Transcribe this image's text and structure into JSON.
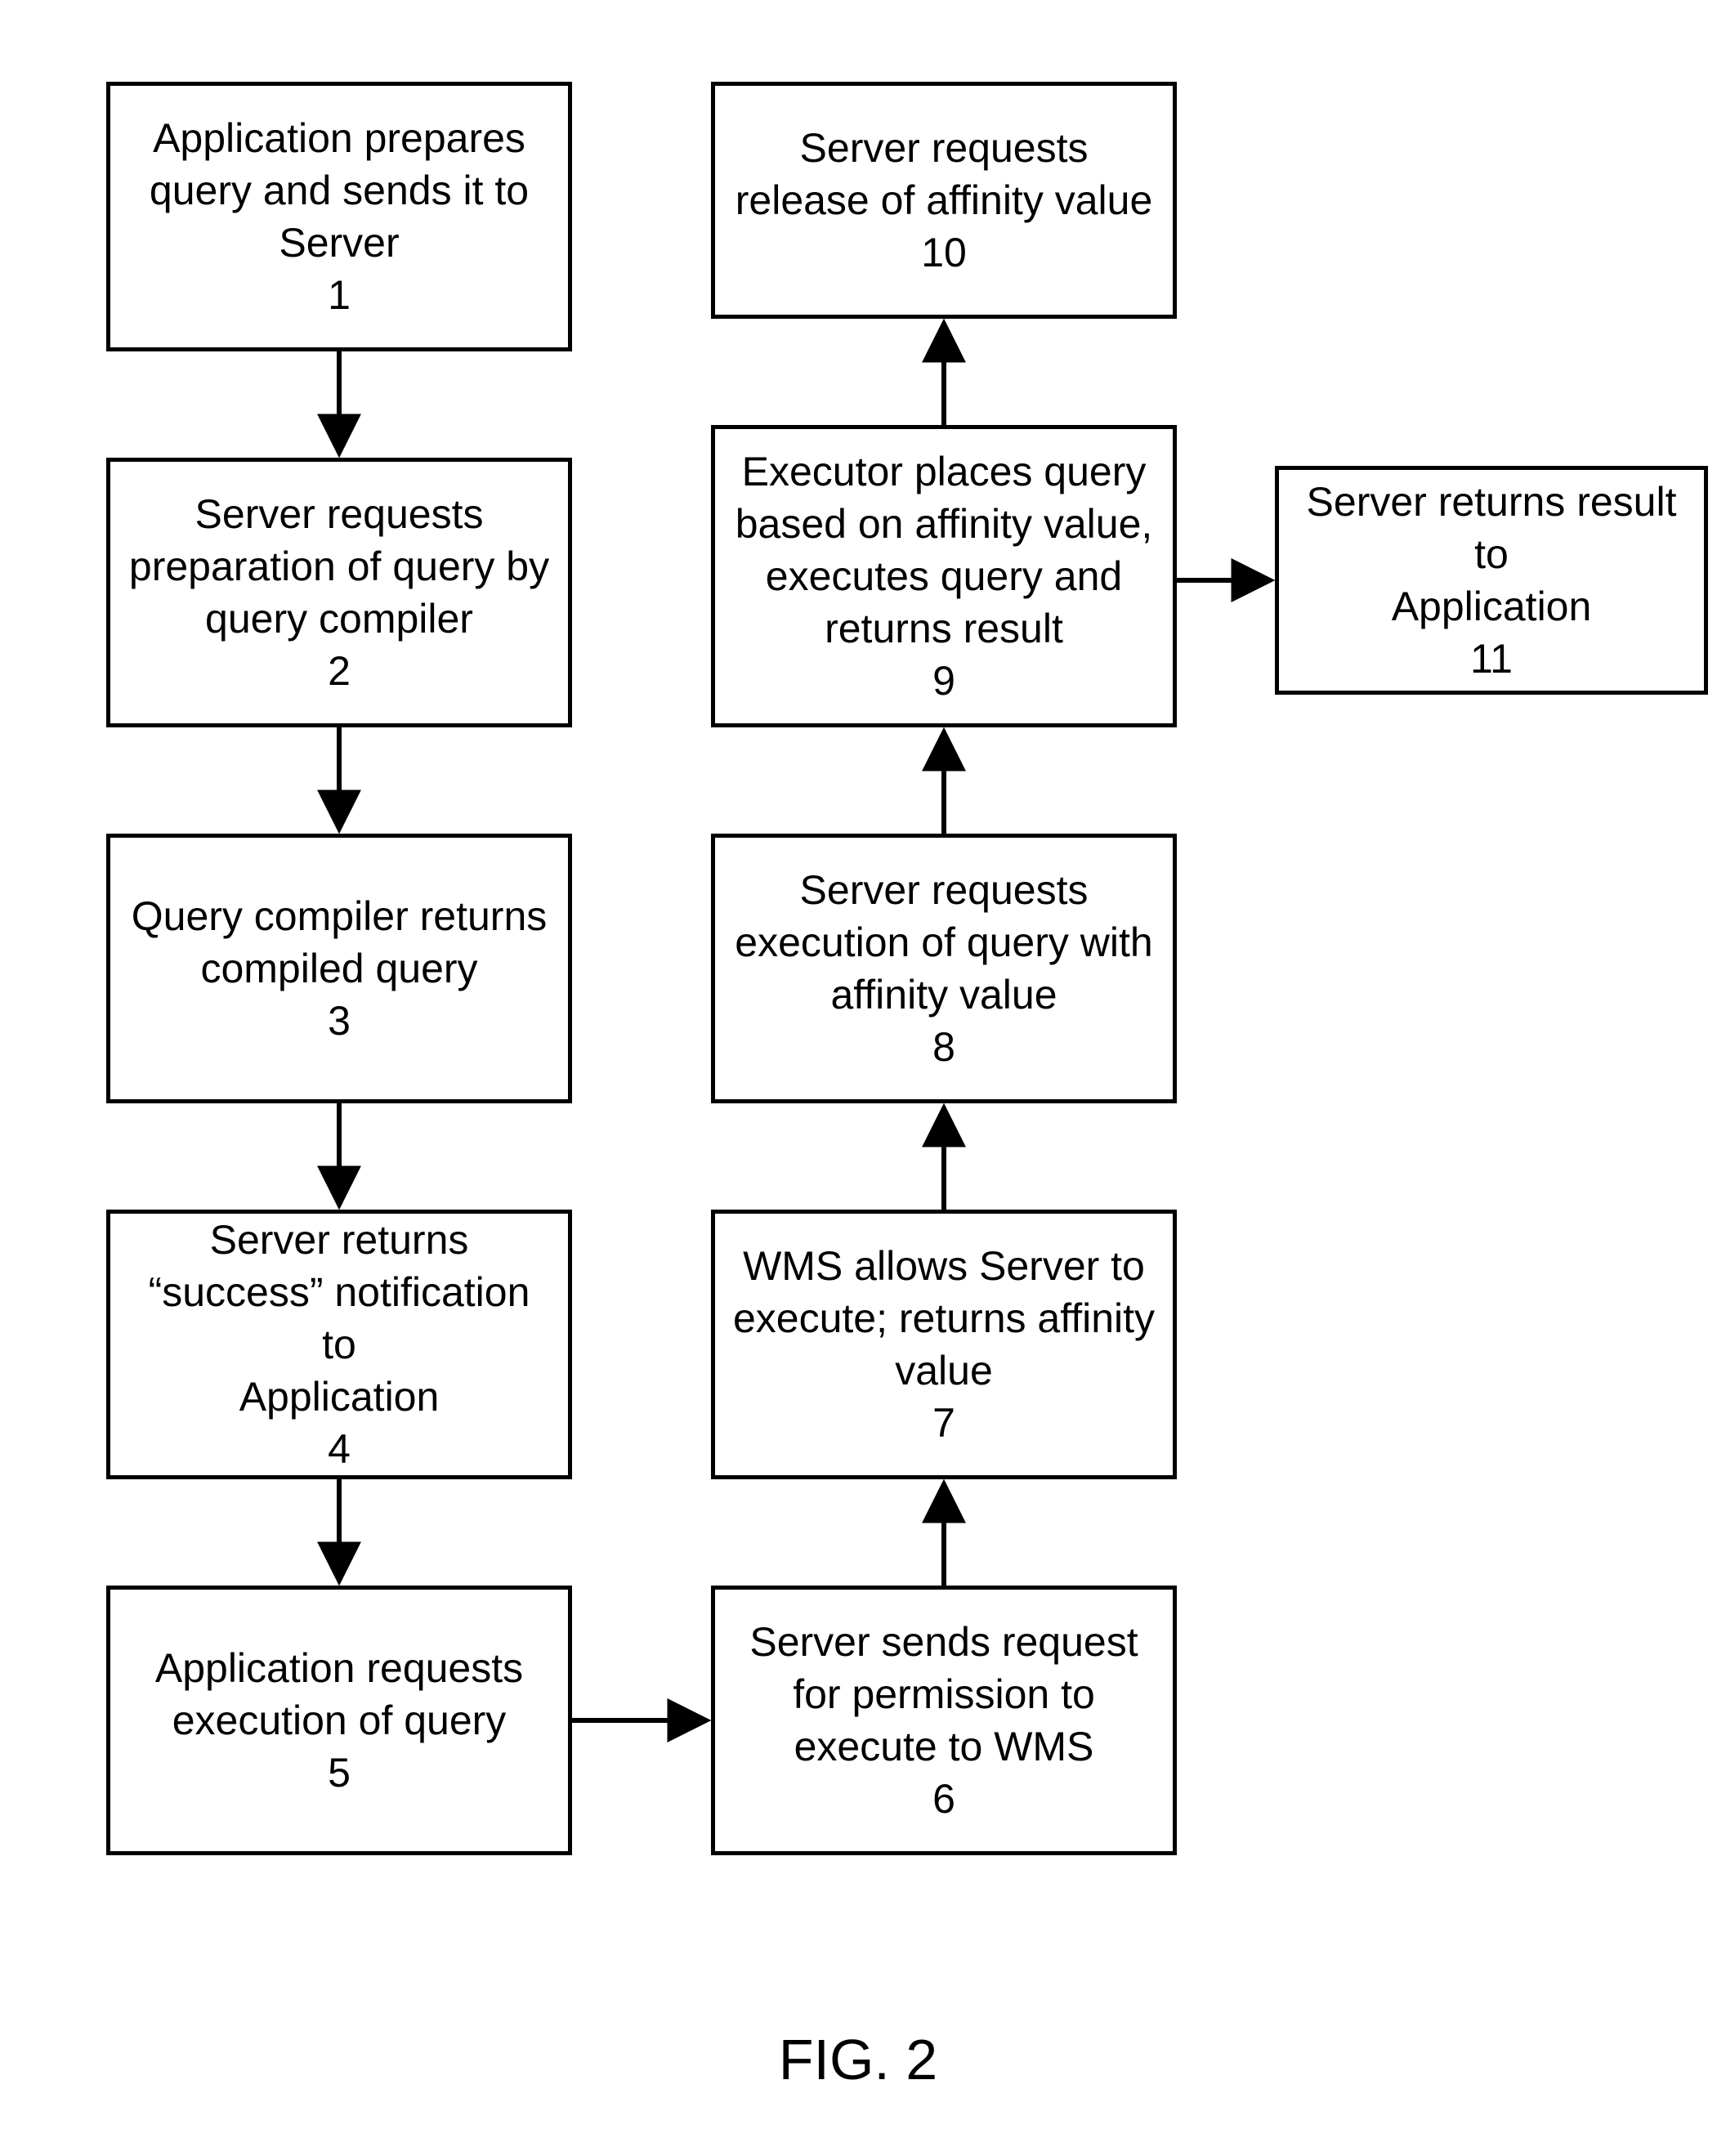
{
  "caption": "FIG. 2",
  "boxes": {
    "b1": "Application prepares\nquery and sends it to\nServer\n1",
    "b2": "Server requests\npreparation of query by\nquery compiler\n2",
    "b3": "Query compiler returns\ncompiled query\n3",
    "b4": "Server returns\n“success” notification to\nApplication\n4",
    "b5": "Application requests\nexecution of query\n5",
    "b6": "Server sends request\nfor permission to\nexecute to WMS\n6",
    "b7": "WMS allows Server to\nexecute; returns affinity\nvalue\n7",
    "b8": "Server requests\nexecution of query with\naffinity value\n8",
    "b9": "Executor places query\nbased on affinity value,\nexecutes query and\nreturns result\n9",
    "b10": "Server requests\nrelease of affinity value\n10",
    "b11": "Server returns result to\nApplication\n11"
  }
}
